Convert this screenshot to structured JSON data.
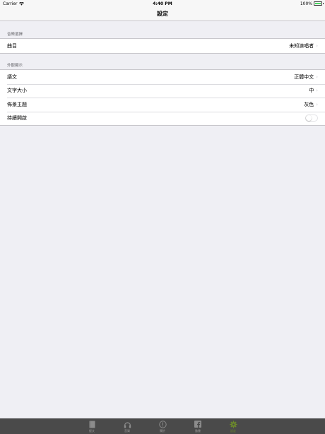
{
  "status_bar": {
    "carrier": "Carrier",
    "time": "4:40 PM",
    "battery": "100%",
    "battery_level": 1.0
  },
  "nav": {
    "title": "設定"
  },
  "sections": [
    {
      "header": "音樂選擇",
      "rows": [
        {
          "label": "曲目",
          "value": "未知演唱者"
        }
      ]
    },
    {
      "header": "外觀顯示",
      "rows": [
        {
          "label": "語文",
          "value": "正體中文"
        },
        {
          "label": "文字大小",
          "value": "中"
        },
        {
          "label": "佈景主題",
          "value": "灰色"
        },
        {
          "label": "持續開啟",
          "toggle": false
        }
      ]
    }
  ],
  "tabs": [
    {
      "label": "經文",
      "icon": "book-icon"
    },
    {
      "label": "音樂",
      "icon": "headphones-icon"
    },
    {
      "label": "關於",
      "icon": "info-icon"
    },
    {
      "label": "臉書",
      "icon": "facebook-icon"
    },
    {
      "label": "設定",
      "icon": "gear-icon",
      "active": true
    }
  ],
  "colors": {
    "background": "#efeff4",
    "tab_bar": "#4a4a4a",
    "active_tab": "#6c8a2a"
  }
}
